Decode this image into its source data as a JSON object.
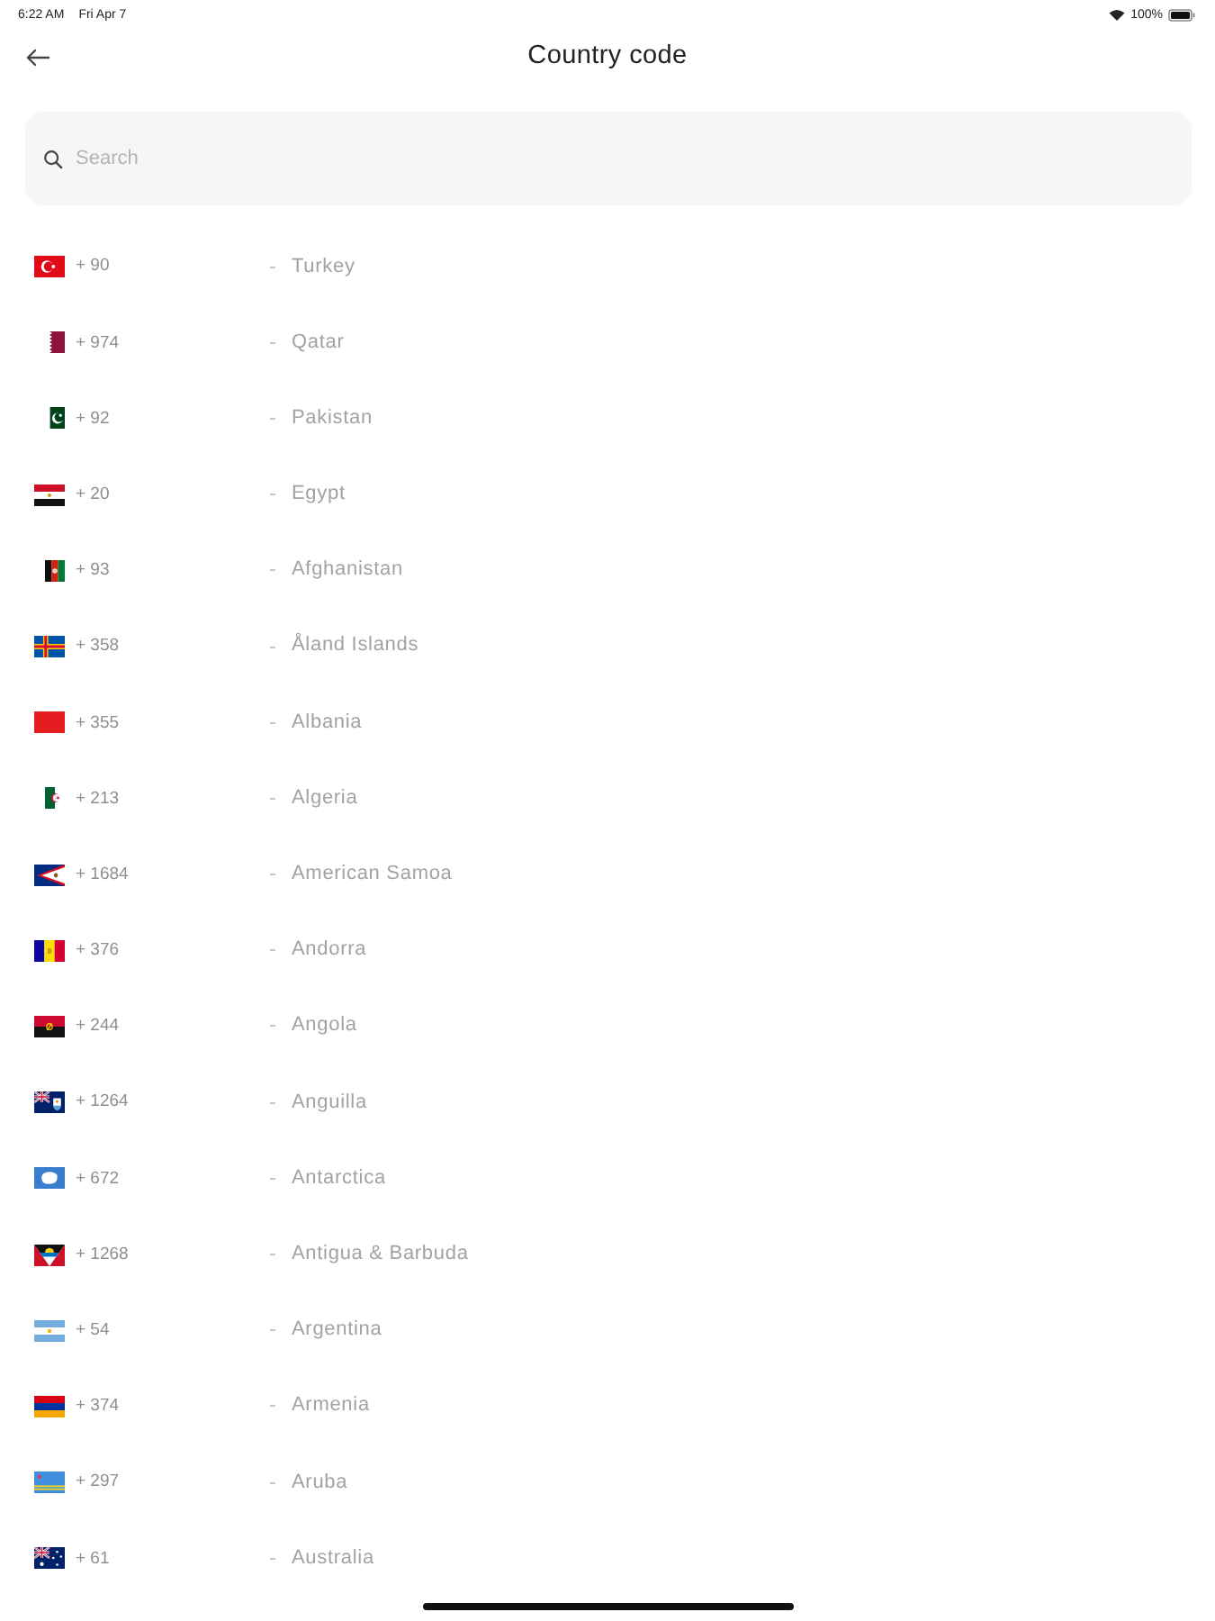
{
  "status_bar": {
    "time": "6:22 AM",
    "date": "Fri Apr 7",
    "battery": "100%"
  },
  "header": {
    "title": "Country code"
  },
  "search": {
    "placeholder": "Search"
  },
  "countries": [
    {
      "kind": "tr",
      "code": "+ 90",
      "name": "Turkey"
    },
    {
      "kind": "qa",
      "code": "+ 974",
      "name": "Qatar"
    },
    {
      "kind": "pk",
      "code": "+ 92",
      "name": "Pakistan"
    },
    {
      "kind": "eg",
      "code": "+ 20",
      "name": "Egypt"
    },
    {
      "kind": "af",
      "code": "+ 93",
      "name": "Afghanistan"
    },
    {
      "kind": "ax",
      "code": "+ 358",
      "name": "Åland Islands"
    },
    {
      "kind": "al",
      "code": "+ 355",
      "name": "Albania"
    },
    {
      "kind": "dz",
      "code": "+ 213",
      "name": "Algeria"
    },
    {
      "kind": "as",
      "code": "+ 1684",
      "name": "American Samoa"
    },
    {
      "kind": "ad",
      "code": "+ 376",
      "name": "Andorra"
    },
    {
      "kind": "ao",
      "code": "+ 244",
      "name": "Angola"
    },
    {
      "kind": "ai",
      "code": "+ 1264",
      "name": "Anguilla"
    },
    {
      "kind": "aq",
      "code": "+ 672",
      "name": "Antarctica"
    },
    {
      "kind": "ag",
      "code": "+ 1268",
      "name": "Antigua & Barbuda"
    },
    {
      "kind": "ar",
      "code": "+ 54",
      "name": "Argentina"
    },
    {
      "kind": "am",
      "code": "+ 374",
      "name": "Armenia"
    },
    {
      "kind": "aw",
      "code": "+ 297",
      "name": "Aruba"
    },
    {
      "kind": "au",
      "code": "+ 61",
      "name": "Australia"
    }
  ]
}
